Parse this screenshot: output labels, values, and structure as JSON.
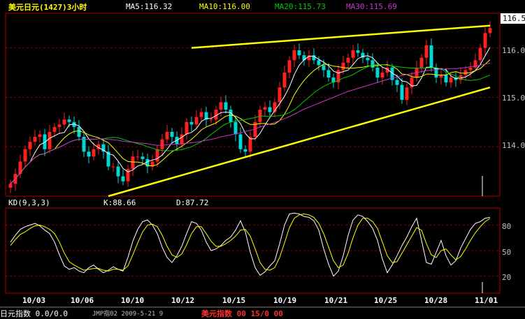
{
  "colors": {
    "background": "#000000",
    "frame": "#b00000",
    "grid": "#8a0000",
    "candle_up": "#ff2020",
    "candle_down": "#00d8d8",
    "ma5": "#ffffff",
    "ma10": "#ffff00",
    "ma20": "#00cc00",
    "ma30": "#cc33cc",
    "trendline": "#ffff00",
    "k_line": "#ffffff",
    "d_line": "#ffff00",
    "axis_text": "#c0c0c0",
    "date_text": "#ffffff",
    "title_text": "#ffff00"
  },
  "header": {
    "symbol": "美元日元(1427)3小时",
    "ma5": "MA5:116.32",
    "ma10": "MA10:116.00",
    "ma20": "MA20:115.73",
    "ma30": "MA30:115.69"
  },
  "kd_header": {
    "name": "KD(9,3,3)",
    "k": "K:88.66",
    "d": "D:87.72"
  },
  "price_axis": {
    "current": "116.50",
    "ticks": [
      "116.00",
      "115.00",
      "114.00"
    ]
  },
  "kd_axis": {
    "ticks": [
      "80",
      "50",
      "20"
    ]
  },
  "dates": [
    "10/03",
    "10/06",
    "10/10",
    "10/12",
    "10/15",
    "10/19",
    "10/21",
    "10/25",
    "10/28",
    "11/01"
  ],
  "status_bar": {
    "item1": "日元指数 0.0/0.0",
    "item2": "JMP指02 2009-5-21 9",
    "item3": "美元指数 00 15/0 00"
  },
  "chart_data": [
    {
      "type": "candlestick",
      "title": "美元日元(1427)3小时",
      "x_labels": [
        "10/03",
        "10/06",
        "10/10",
        "10/12",
        "10/15",
        "10/19",
        "10/21",
        "10/25",
        "10/28",
        "11/01"
      ],
      "ylim": [
        113.0,
        116.7
      ],
      "y_ticks": [
        114.0,
        115.0,
        116.0
      ],
      "last_price": 116.5,
      "grid": true,
      "legend": "top",
      "close": [
        113.25,
        113.45,
        113.7,
        113.95,
        114.1,
        114.2,
        114.25,
        113.95,
        114.3,
        114.4,
        114.45,
        114.55,
        114.5,
        114.4,
        114.2,
        113.9,
        113.8,
        113.95,
        114.05,
        113.9,
        113.6,
        113.6,
        113.4,
        113.3,
        113.55,
        113.8,
        113.8,
        113.75,
        113.6,
        113.7,
        113.95,
        114.15,
        114.3,
        114.2,
        114.05,
        114.25,
        114.5,
        114.45,
        114.6,
        114.7,
        114.55,
        114.55,
        114.75,
        114.9,
        114.75,
        114.5,
        114.25,
        113.95,
        113.9,
        114.2,
        114.5,
        114.75,
        114.8,
        114.7,
        114.9,
        115.2,
        115.5,
        115.75,
        115.95,
        115.85,
        115.75,
        115.85,
        115.75,
        115.65,
        115.55,
        115.4,
        115.3,
        115.55,
        115.7,
        115.8,
        115.95,
        115.9,
        115.8,
        115.75,
        115.6,
        115.4,
        115.5,
        115.6,
        115.35,
        115.25,
        114.95,
        115.2,
        115.4,
        115.6,
        115.8,
        116.05,
        115.6,
        115.4,
        115.45,
        115.3,
        115.4,
        115.35,
        115.45,
        115.55,
        115.6,
        115.75,
        116.0,
        116.3,
        116.4
      ],
      "series": [
        {
          "name": "MA5",
          "values": [
            113.25,
            113.35,
            113.47,
            113.59,
            113.69,
            113.88,
            114.04,
            114.09,
            114.17,
            114.22,
            114.27,
            114.29,
            114.44,
            114.46,
            114.42,
            114.31,
            114.16,
            114.05,
            113.98,
            113.93,
            113.86,
            113.83,
            113.71,
            113.56,
            113.49,
            113.53,
            113.61,
            113.64,
            113.7,
            113.73,
            113.76,
            113.83,
            113.95,
            114.08,
            114.13,
            114.19,
            114.26,
            114.29,
            114.37,
            114.51,
            114.57,
            114.57,
            114.63,
            114.69,
            114.7,
            114.69,
            114.59,
            114.47,
            114.27,
            114.16,
            114.16,
            114.27,
            114.44,
            114.59,
            114.73,
            114.87,
            115.02,
            115.21,
            115.46,
            115.65,
            115.76,
            115.83,
            115.83,
            115.77,
            115.71,
            115.64,
            115.53,
            115.49,
            115.52,
            115.55,
            115.66,
            115.78,
            115.83,
            115.84,
            115.8,
            115.69,
            115.61,
            115.57,
            115.49,
            115.43,
            115.33,
            115.31,
            115.23,
            115.24,
            115.39,
            115.61,
            115.61,
            115.57,
            115.58,
            115.56,
            115.43,
            115.38,
            115.39,
            115.41,
            115.47,
            115.54,
            115.66,
            115.84,
            116.01
          ]
        },
        {
          "name": "MA10",
          "values": [
            113.25,
            113.35,
            113.47,
            113.59,
            113.69,
            113.78,
            113.84,
            113.86,
            113.91,
            113.95,
            114.07,
            114.18,
            114.26,
            114.31,
            114.32,
            114.29,
            114.24,
            114.21,
            114.18,
            114.13,
            114.08,
            113.98,
            113.87,
            113.76,
            113.7,
            113.69,
            113.69,
            113.67,
            113.62,
            113.61,
            113.64,
            113.72,
            113.81,
            113.9,
            113.95,
            114.01,
            114.08,
            114.15,
            114.24,
            114.34,
            114.4,
            114.44,
            114.48,
            114.55,
            114.62,
            114.64,
            114.62,
            114.57,
            114.5,
            114.45,
            114.45,
            114.47,
            114.47,
            114.45,
            114.46,
            114.53,
            114.66,
            114.84,
            115.05,
            115.21,
            115.34,
            115.45,
            115.54,
            115.61,
            115.67,
            115.66,
            115.63,
            115.62,
            115.6,
            115.59,
            115.59,
            115.6,
            115.61,
            115.63,
            115.64,
            115.64,
            115.66,
            115.66,
            115.63,
            115.57,
            115.47,
            115.46,
            115.42,
            115.4,
            115.42,
            115.47,
            115.47,
            115.45,
            115.45,
            115.45,
            115.5,
            115.52,
            115.49,
            115.49,
            115.5,
            115.54,
            115.58,
            115.67,
            115.76
          ]
        },
        {
          "name": "MA20",
          "values": [
            113.25,
            113.35,
            113.47,
            113.59,
            113.69,
            113.78,
            113.84,
            113.86,
            113.91,
            113.95,
            113.99,
            114.04,
            114.09,
            114.13,
            114.15,
            114.15,
            114.15,
            114.15,
            114.16,
            114.16,
            114.18,
            114.19,
            114.18,
            114.15,
            114.12,
            114.09,
            114.06,
            114.04,
            114.0,
            113.97,
            113.94,
            113.92,
            113.92,
            113.92,
            113.93,
            113.94,
            113.97,
            114.0,
            114.05,
            114.1,
            114.17,
            114.25,
            114.32,
            114.4,
            114.46,
            114.5,
            114.52,
            114.53,
            114.55,
            114.57,
            114.59,
            114.62,
            114.62,
            114.61,
            114.62,
            114.63,
            114.65,
            114.69,
            114.75,
            114.83,
            114.92,
            115.0,
            115.09,
            115.16,
            115.22,
            115.27,
            115.31,
            115.34,
            115.39,
            115.42,
            115.46,
            115.52,
            115.57,
            115.62,
            115.65,
            115.66,
            115.66,
            115.65,
            115.63,
            115.62,
            115.61,
            115.6,
            115.59,
            115.59,
            115.59,
            115.59,
            115.6,
            115.6,
            115.57,
            115.52,
            115.47,
            115.43,
            115.38,
            115.35,
            115.34,
            115.35,
            115.37,
            115.41,
            115.45
          ]
        },
        {
          "name": "MA30",
          "values": [
            113.25,
            113.35,
            113.47,
            113.59,
            113.69,
            113.78,
            113.84,
            113.86,
            113.91,
            113.95,
            113.99,
            114.04,
            114.09,
            114.13,
            114.15,
            114.15,
            114.15,
            114.15,
            114.16,
            114.16,
            114.15,
            114.14,
            114.13,
            114.11,
            114.1,
            114.09,
            114.08,
            114.07,
            114.06,
            114.04,
            114.03,
            114.03,
            114.04,
            114.05,
            114.05,
            114.06,
            114.07,
            114.08,
            114.09,
            114.11,
            114.13,
            114.15,
            114.17,
            114.2,
            114.22,
            114.24,
            114.26,
            114.28,
            114.31,
            114.33,
            114.36,
            114.4,
            114.43,
            114.46,
            114.49,
            114.53,
            114.57,
            114.61,
            114.66,
            114.71,
            114.76,
            114.8,
            114.84,
            114.88,
            114.92,
            114.96,
            115.0,
            115.04,
            115.08,
            115.12,
            115.15,
            115.18,
            115.21,
            115.24,
            115.27,
            115.3,
            115.33,
            115.36,
            115.39,
            115.41,
            115.44,
            115.46,
            115.48,
            115.5,
            115.52,
            115.54,
            115.55,
            115.56,
            115.57,
            115.57,
            115.58,
            115.58,
            115.59,
            115.6,
            115.62,
            115.63,
            115.65,
            115.67,
            115.69
          ]
        }
      ],
      "trendlines": [
        {
          "name": "upper",
          "from": [
            37,
            116.0
          ],
          "to": [
            98,
            116.45
          ]
        },
        {
          "name": "lower",
          "from": [
            20,
            113.0
          ],
          "to": [
            98,
            115.2
          ]
        }
      ]
    },
    {
      "type": "line",
      "title": "KD(9,3,3)",
      "ylim": [
        0,
        100
      ],
      "y_ticks": [
        20,
        50,
        80
      ],
      "grid": true,
      "series": [
        {
          "name": "K",
          "values": [
            60,
            68,
            75,
            78,
            80,
            82,
            79,
            74,
            70,
            60,
            45,
            32,
            28,
            30,
            26,
            24,
            30,
            33,
            28,
            24,
            27,
            31,
            28,
            26,
            42,
            61,
            75,
            84,
            86,
            80,
            70,
            54,
            42,
            36,
            44,
            55,
            70,
            84,
            82,
            74,
            60,
            50,
            52,
            56,
            62,
            66,
            74,
            85,
            72,
            48,
            30,
            21,
            25,
            32,
            38,
            58,
            80,
            93,
            94,
            93,
            90,
            89,
            85,
            74,
            52,
            34,
            20,
            26,
            44,
            68,
            86,
            92,
            90,
            84,
            76,
            62,
            40,
            24,
            33,
            44,
            56,
            66,
            78,
            88,
            62,
            36,
            34,
            48,
            62,
            44,
            33,
            38,
            53,
            64,
            75,
            82,
            84,
            88,
            89
          ]
        },
        {
          "name": "D",
          "values": [
            56,
            63,
            69,
            72,
            76,
            79,
            80,
            78,
            75,
            70,
            60,
            47,
            37,
            33,
            30,
            27,
            28,
            29,
            29,
            27,
            26,
            28,
            28,
            27,
            32,
            45,
            59,
            72,
            80,
            81,
            78,
            68,
            55,
            45,
            42,
            46,
            57,
            70,
            78,
            78,
            70,
            61,
            55,
            55,
            58,
            62,
            67,
            74,
            75,
            67,
            52,
            36,
            28,
            27,
            30,
            42,
            59,
            77,
            88,
            92,
            93,
            92,
            89,
            82,
            70,
            54,
            38,
            30,
            33,
            47,
            65,
            80,
            88,
            88,
            84,
            76,
            60,
            44,
            36,
            37,
            47,
            57,
            67,
            77,
            74,
            58,
            45,
            42,
            50,
            52,
            45,
            39,
            43,
            52,
            62,
            71,
            78,
            84,
            87.72
          ]
        }
      ]
    }
  ]
}
